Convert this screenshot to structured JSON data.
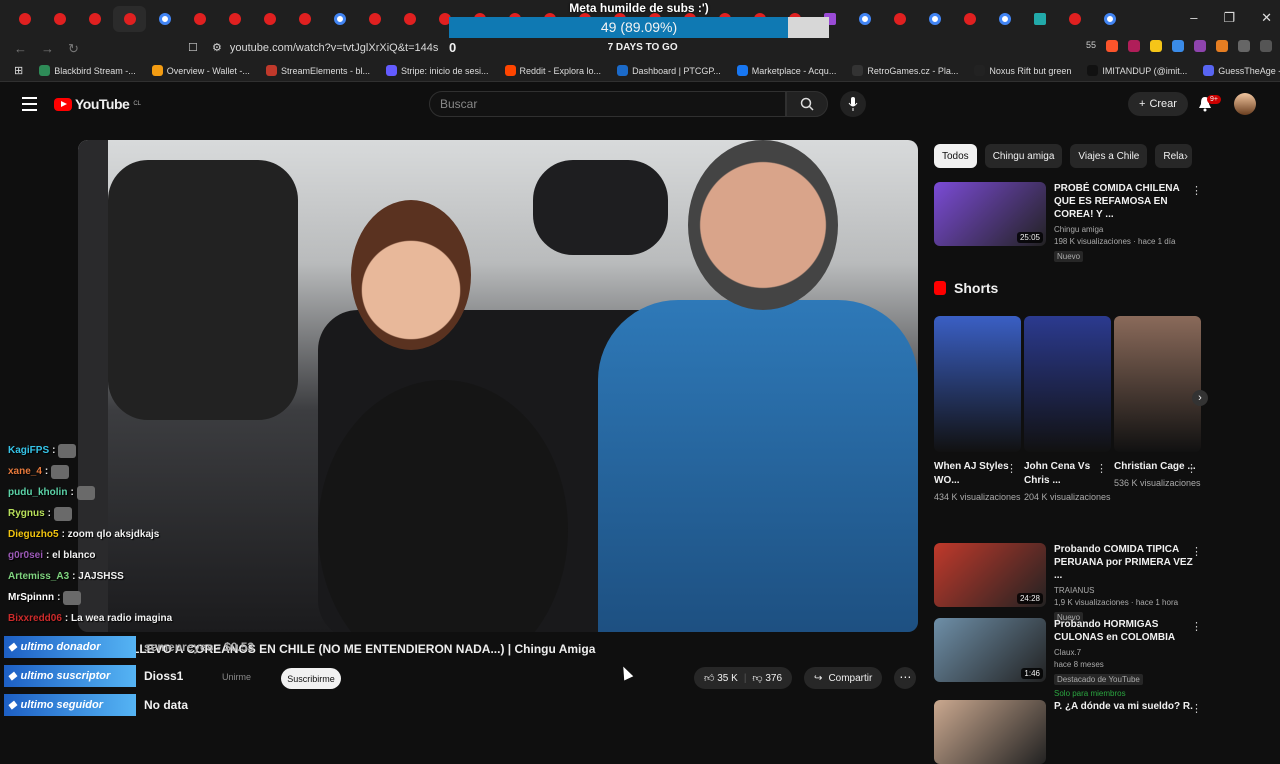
{
  "browser": {
    "url": "youtube.com/watch?v=tvtJglXrXiQ&t=144s",
    "bookmarks": [
      "Blackbird Stream -...",
      "Overview - Wallet -...",
      "StreamElements - bl...",
      "Stripe: inicio de sesi...",
      "Reddit - Explora lo...",
      "Dashboard | PTCGP...",
      "Marketplace - Acqu...",
      "RetroGames.cz - Pla...",
      "Noxus Rift but green",
      "IMITANDUP (@imit...",
      "GuessTheAge - Play..."
    ],
    "ext_badge": "55"
  },
  "goal": {
    "title": "Meta humilde de subs :')",
    "progress_text": "49 (89.09%)",
    "progress": 0.8909,
    "left_count": "0",
    "days_left": "7 DAYS TO GO"
  },
  "header": {
    "logo_text": "YouTube",
    "country": "CL",
    "search_placeholder": "Buscar",
    "create_label": "Crear",
    "notif_badge": "9+"
  },
  "video": {
    "title_ghost": "LLEVO A COREANOS EN CHILE (NO ME ENTENDIERON NADA...) | Chingu Amiga",
    "join_label": "Unirme",
    "subscribe_label": "Suscribirme",
    "likes": "35 K",
    "dislikes": "376",
    "share_label": "Compartir"
  },
  "chat": [
    {
      "user": "KagiFPS",
      "text": ":",
      "color": "#36c4e8",
      "emote": true
    },
    {
      "user": "xane_4",
      "text": ":",
      "color": "#e87a3c",
      "emote": true
    },
    {
      "user": "pudu_kholin",
      "text": ":",
      "color": "#5cd3a8",
      "emote": true
    },
    {
      "user": "Rygnus",
      "text": ":",
      "color": "#b8e05a",
      "emote": true
    },
    {
      "user": "Dieguzho5",
      "text": ": zoom qlo aksjdkajs",
      "color": "#f1c40f",
      "emote": false
    },
    {
      "user": "g0r0sei",
      "text": ": el blanco",
      "color": "#9b59b6",
      "emote": false
    },
    {
      "user": "Artemiss_A3",
      "text": ": JAJSHSS",
      "color": "#7fd37f",
      "emote": false
    },
    {
      "user": "MrSpinnn",
      "text": ":",
      "color": "#ffffff",
      "emote": true
    },
    {
      "user": "Bixxredd06",
      "text": ": La wea radio imagina",
      "color": "#cc2b2b",
      "emote": false
    }
  ],
  "overlay": [
    {
      "label": "ultimo donador",
      "value": "semenreyes - $0.53"
    },
    {
      "label": "ultimo suscriptor",
      "value": "Dioss1"
    },
    {
      "label": "ultimo seguidor",
      "value": "No data"
    }
  ],
  "sidebar": {
    "chips": [
      "Todos",
      "Chingu amiga",
      "Viajes a Chile",
      "Rela"
    ],
    "recs": [
      {
        "title": "PROBÉ COMIDA CHILENA QUE ES REFAMOSA EN COREA! Y ...",
        "channel": "Chingu amiga",
        "meta": "198 K visualizaciones · hace 1 día",
        "badge": "Nuevo",
        "duration": "25:05",
        "thumb_color": "#7b4bd6"
      },
      {
        "title": "Probando COMIDA TIPICA PERUANA por PRIMERA VEZ ...",
        "channel": "TRAIANUS",
        "meta": "1,9 K visualizaciones · hace 1 hora",
        "badge": "Nuevo",
        "duration": "24:28",
        "thumb_color": "#c0392b"
      },
      {
        "title": "Probando HORMIGAS CULONAS en COLOMBIA",
        "channel": "Claux.7",
        "meta": "hace 8 meses",
        "badge": "Destacado de YouTube",
        "extra": "Solo para miembros",
        "duration": "1:46",
        "thumb_color": "#6e8fa8"
      },
      {
        "title": "P. ¿A dónde va mi sueldo? R.",
        "channel": "",
        "meta": "",
        "badge": "",
        "duration": "",
        "thumb_color": "#caa88f"
      }
    ],
    "shorts_label": "Shorts",
    "shorts": [
      {
        "title": "When AJ Styles WO...",
        "views": "434 K visualizaciones",
        "color": "#3a5fc4"
      },
      {
        "title": "John Cena Vs Chris ...",
        "views": "204 K visualizaciones",
        "color": "#2b3a8f"
      },
      {
        "title": "Christian Cage ...",
        "views": "536 K visualizaciones",
        "color": "#8a6a5a"
      }
    ]
  }
}
